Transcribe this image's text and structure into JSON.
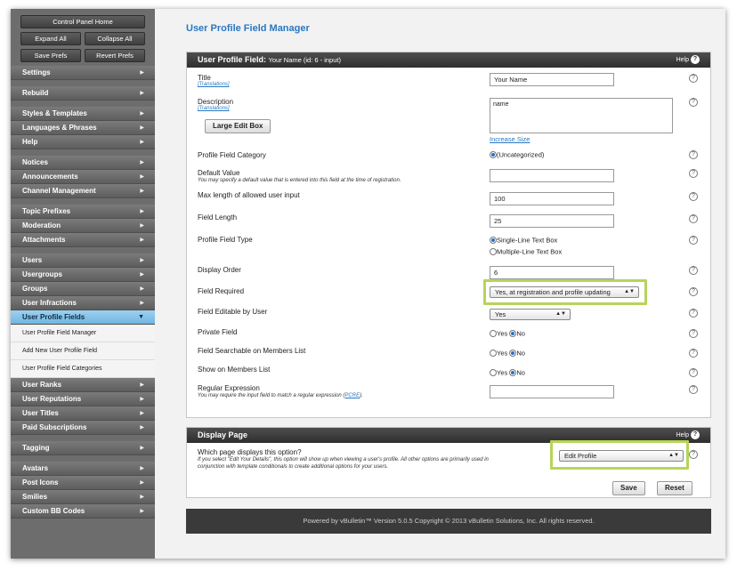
{
  "sidebar": {
    "control_panel_home": "Control Panel Home",
    "expand_all": "Expand All",
    "collapse_all": "Collapse All",
    "save_prefs": "Save Prefs",
    "revert_prefs": "Revert Prefs",
    "groups": [
      [
        "Settings"
      ],
      [
        "Rebuild"
      ],
      [
        "Styles & Templates",
        "Languages & Phrases",
        "Help"
      ],
      [
        "Notices",
        "Announcements",
        "Channel Management"
      ],
      [
        "Topic Prefixes",
        "Moderation",
        "Attachments"
      ],
      [
        "Users",
        "Usergroups",
        "Groups",
        "User Infractions"
      ]
    ],
    "active_item": "User Profile Fields",
    "sub_items": [
      "User Profile Field Manager",
      "Add New User Profile Field",
      "User Profile Field Categories"
    ],
    "groups_after": [
      [
        "User Ranks",
        "User Reputations",
        "User Titles",
        "Paid Subscriptions"
      ],
      [
        "Tagging"
      ],
      [
        "Avatars",
        "Post Icons",
        "Smilies",
        "Custom BB Codes"
      ]
    ]
  },
  "page_title": "User Profile Field Manager",
  "panel1": {
    "heading": "User Profile Field:",
    "heading_sub": "Your Name (id: 6 - input)",
    "help_label": "Help",
    "title_label": "Title",
    "translations": "[Translations]",
    "title_value": "Your Name",
    "description_label": "Description",
    "description_value": "name",
    "large_edit_box": "Large Edit Box",
    "increase_size": "Increase Size",
    "category_label": "Profile Field Category",
    "category_value": "(Uncategorized)",
    "default_value_label": "Default Value",
    "default_value_note": "You may specify a default value that is entered into this field at the time of registration.",
    "max_length_label": "Max length of allowed user input",
    "max_length_value": "100",
    "field_length_label": "Field Length",
    "field_length_value": "25",
    "field_type_label": "Profile Field Type",
    "field_type_single": "Single-Line Text Box",
    "field_type_multi": "Multiple-Line Text Box",
    "display_order_label": "Display Order",
    "display_order_value": "6",
    "required_label": "Field Required",
    "required_value": "Yes, at registration and profile updating",
    "editable_label": "Field Editable by User",
    "editable_value": "Yes",
    "private_label": "Private Field",
    "searchable_label": "Field Searchable on Members List",
    "show_members_label": "Show on Members List",
    "yes": "Yes",
    "no": "No",
    "regex_label": "Regular Expression",
    "regex_note": "You may require the input field to match a regular expression (",
    "pcre": "PCRE",
    "regex_note_end": ")."
  },
  "panel2": {
    "heading": "Display Page",
    "help_label": "Help",
    "question": "Which page displays this option?",
    "note": "If you select \"Edit Your Details\", this option will show up when viewing a user's profile. All other options are primarily used in conjunction with template conditionals to create additional options for your users.",
    "select_value": "Edit Profile",
    "save": "Save",
    "reset": "Reset"
  },
  "footer": "Powered by vBulletin™ Version 5.0.5 Copyright © 2013 vBulletin Solutions, Inc. All rights reserved.",
  "colors": {
    "accent": "#2a78c0",
    "highlight": "#b6d45a",
    "active_nav": "#7fc0e8"
  }
}
